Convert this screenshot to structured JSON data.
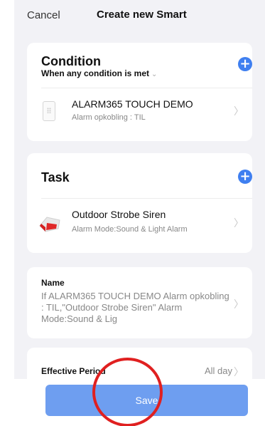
{
  "header": {
    "cancel_label": "Cancel",
    "title": "Create new Smart"
  },
  "condition": {
    "title": "Condition",
    "subtitle": "When any condition is met",
    "items": [
      {
        "title": "ALARM365 TOUCH DEMO",
        "subtitle": "Alarm opkobling : TIL",
        "icon": "alarm-keypad-icon"
      }
    ]
  },
  "task": {
    "title": "Task",
    "items": [
      {
        "title": "Outdoor Strobe Siren",
        "subtitle": "Alarm Mode:Sound & Light Alarm",
        "icon": "strobe-siren-icon"
      }
    ]
  },
  "name_section": {
    "label": "Name",
    "value": "If ALARM365 TOUCH DEMO Alarm opkobling : TIL,\"Outdoor Strobe Siren\" Alarm Mode:Sound & Lig"
  },
  "effective_period": {
    "label": "Effective Period",
    "value": "All day"
  },
  "footer": {
    "save_label": "Save"
  },
  "colors": {
    "accent": "#3f7ff0",
    "save_button": "#6e9ef0",
    "annotation": "#e02020"
  }
}
